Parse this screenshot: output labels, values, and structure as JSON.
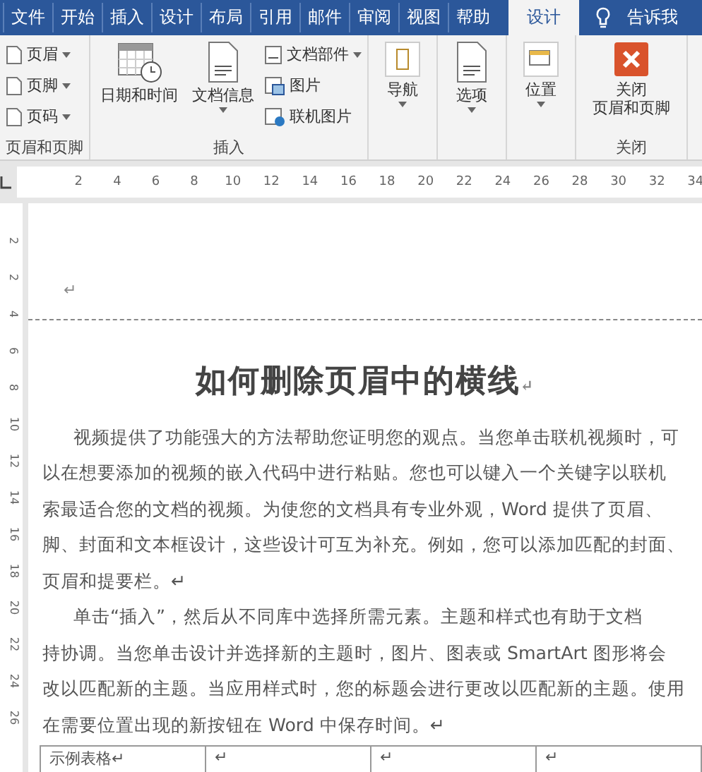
{
  "tabs": [
    {
      "label": "文件",
      "selected": false
    },
    {
      "label": "开始",
      "selected": false
    },
    {
      "label": "插入",
      "selected": false
    },
    {
      "label": "设计",
      "selected": false
    },
    {
      "label": "布局",
      "selected": false
    },
    {
      "label": "引用",
      "selected": false
    },
    {
      "label": "邮件",
      "selected": false
    },
    {
      "label": "审阅",
      "selected": false
    },
    {
      "label": "视图",
      "selected": false
    },
    {
      "label": "帮助",
      "selected": false
    },
    {
      "label": "设计",
      "selected": true
    }
  ],
  "tell_me": "告诉我",
  "ribbon": {
    "groups": [
      {
        "label": "页眉和页脚",
        "kind": "list",
        "items": [
          {
            "label": "页眉",
            "kind": "page",
            "dropdown": true
          },
          {
            "label": "页脚",
            "kind": "page",
            "dropdown": true
          },
          {
            "label": "页码",
            "kind": "page",
            "dropdown": true
          }
        ]
      },
      {
        "label": "插入",
        "kind": "insert",
        "big": [
          {
            "lines": [
              "日期和时间"
            ],
            "kind": "calendar",
            "dropdown": false
          },
          {
            "lines": [
              "文档信息"
            ],
            "kind": "doc",
            "dropdown": true
          }
        ],
        "items": [
          {
            "label": "文档部件",
            "kind": "parts",
            "dropdown": true
          },
          {
            "label": "图片",
            "kind": "picture",
            "dropdown": false
          },
          {
            "label": "联机图片",
            "kind": "online",
            "dropdown": false
          }
        ]
      },
      {
        "kind": "big",
        "big": [
          {
            "lines": [
              "导航"
            ],
            "kind": "nav",
            "dropdown": true
          }
        ]
      },
      {
        "kind": "big",
        "big": [
          {
            "lines": [
              "选项"
            ],
            "kind": "doc",
            "dropdown": true
          }
        ]
      },
      {
        "kind": "big",
        "big": [
          {
            "lines": [
              "位置"
            ],
            "kind": "position",
            "dropdown": true
          }
        ]
      },
      {
        "label": "关闭",
        "kind": "big",
        "big": [
          {
            "lines": [
              "关闭",
              "页眉和页脚"
            ],
            "kind": "close",
            "dropdown": false
          }
        ]
      }
    ]
  },
  "ruler": {
    "marks": [
      "2",
      "4",
      "6",
      "8",
      "10",
      "12",
      "14",
      "16",
      "18",
      "20",
      "22",
      "24",
      "26",
      "28",
      "30",
      "32",
      "34"
    ]
  },
  "vertical_ruler": {
    "marks": [
      "2",
      "2",
      "4",
      "6",
      "8",
      "10",
      "12",
      "14",
      "16",
      "18",
      "20",
      "22",
      "24",
      "26"
    ]
  },
  "document": {
    "header_mark": "↵",
    "title": "如何删除页眉中的横线",
    "title_mark": "↵",
    "paragraphs": [
      {
        "lines": [
          "视频提供了功能强大的方法帮助您证明您的观点。当您单击联机视频时，可",
          "以在想要添加的视频的嵌入代码中进行粘贴。您也可以键入一个关键字以联机",
          "索最适合您的文档的视频。为使您的文档具有专业外观，Word 提供了页眉、",
          "脚、封面和文本框设计，这些设计可互为补充。例如，您可以添加匹配的封面、",
          "页眉和提要栏。↵"
        ]
      },
      {
        "lines": [
          "单击“插入”，然后从不同库中选择所需元素。主题和样式也有助于文档",
          "持协调。当您单击设计并选择新的主题时，图片、图表或 SmartArt 图形将会",
          "改以匹配新的主题。当应用样式时，您的标题会进行更改以匹配新的主题。使用",
          "在需要位置出现的新按钮在 Word 中保存时间。↵"
        ]
      }
    ],
    "table": {
      "cells": [
        "示例表格↵",
        "↵",
        "↵",
        "↵"
      ]
    }
  }
}
